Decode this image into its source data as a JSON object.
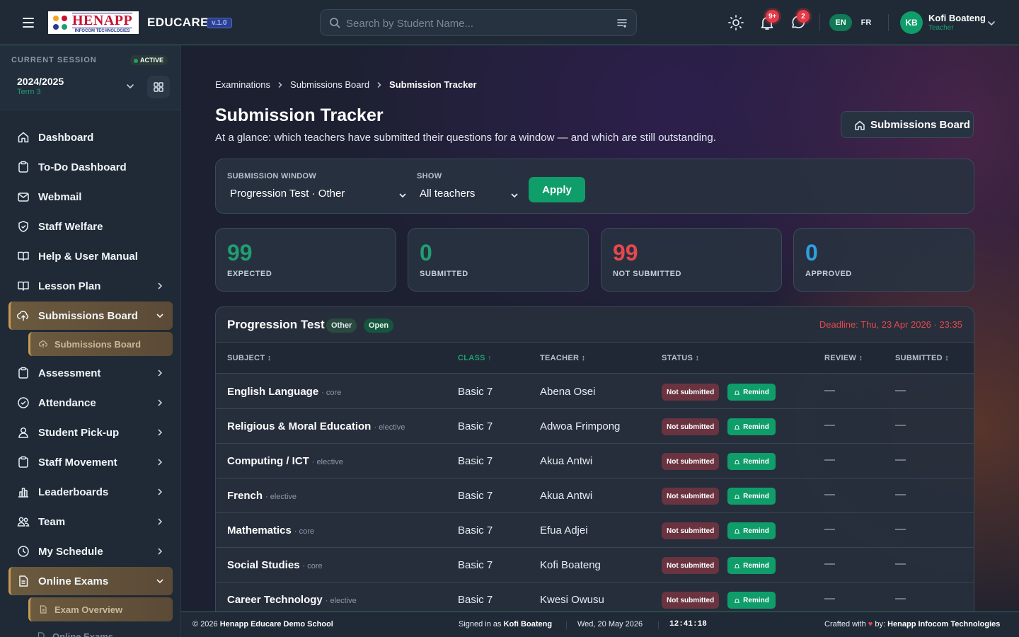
{
  "app": {
    "logo_main": "HENAPP",
    "logo_sub": "INFOCOM TECHNOLOGIES",
    "brand": "EDUCARE",
    "version": "v.1.0"
  },
  "search": {
    "placeholder": "Search by Student Name..."
  },
  "notifications": {
    "alerts_count": "9+",
    "messages_count": "2"
  },
  "languages": [
    "EN",
    "FR"
  ],
  "user": {
    "initials": "KB",
    "name": "Kofi Boateng",
    "role": "Teacher"
  },
  "session": {
    "label": "CURRENT SESSION",
    "status": "ACTIVE",
    "year": "2024/2025",
    "term": "Term 3"
  },
  "sidebar": {
    "items": [
      {
        "label": "Dashboard",
        "icon": "home-icon"
      },
      {
        "label": "To-Do Dashboard",
        "icon": "clipboard-icon"
      },
      {
        "label": "Webmail",
        "icon": "mail-icon"
      },
      {
        "label": "Staff Welfare",
        "icon": "shield-icon"
      },
      {
        "label": "Help & User Manual",
        "icon": "book-icon"
      },
      {
        "label": "Lesson Plan",
        "icon": "book-open-icon"
      },
      {
        "label": "Submissions Board",
        "icon": "upload-cloud-icon"
      },
      {
        "label": "Submissions Board",
        "icon": "sub-icon"
      },
      {
        "label": "Assessment",
        "icon": "clipboard-icon"
      },
      {
        "label": "Attendance",
        "icon": "check-circle-icon"
      },
      {
        "label": "Student Pick-up",
        "icon": "user-icon"
      },
      {
        "label": "Staff Movement",
        "icon": "clipboard-icon"
      },
      {
        "label": "Leaderboards",
        "icon": "bar-chart-icon"
      },
      {
        "label": "Team",
        "icon": "team-icon"
      },
      {
        "label": "My Schedule",
        "icon": "clock-icon"
      },
      {
        "label": "Online Exams",
        "icon": "document-icon"
      },
      {
        "label": "Exam Overview",
        "icon": "sub-icon"
      },
      {
        "label": "Online Exams",
        "icon": "sub-icon"
      }
    ]
  },
  "breadcrumb": [
    "Examinations",
    "Submissions Board",
    "Submission Tracker"
  ],
  "page": {
    "title": "Submission Tracker",
    "subtitle": "At a glance: which teachers have submitted their questions for a window — and which are still outstanding.",
    "header_button": "Submissions Board"
  },
  "filters": {
    "window_label": "SUBMISSION WINDOW",
    "window_value": "Progression Test · Other",
    "show_label": "SHOW",
    "show_value": "All teachers",
    "apply_label": "Apply"
  },
  "stats": [
    {
      "value": "99",
      "label": "EXPECTED",
      "color": "#1f9e72"
    },
    {
      "value": "0",
      "label": "SUBMITTED",
      "color": "#1f9e72"
    },
    {
      "value": "99",
      "label": "NOT SUBMITTED",
      "color": "#e5484d"
    },
    {
      "value": "0",
      "label": "APPROVED",
      "color": "#2f9fe0"
    }
  ],
  "table": {
    "title": "Progression Test",
    "type_pill": "Other",
    "state_pill": "Open",
    "deadline": "Deadline: Thu, 23 Apr 2026 · 23:35",
    "columns": [
      "SUBJECT ↕",
      "CLASS ↑",
      "TEACHER ↕",
      "STATUS ↕",
      "REVIEW ↕",
      "SUBMITTED ↕"
    ],
    "status_label": "Not submitted",
    "remind_label": "Remind",
    "empty_value": "—",
    "rows": [
      {
        "subject": "English Language",
        "tag": "· core",
        "class": "Basic 7",
        "teacher": "Abena Osei"
      },
      {
        "subject": "Religious & Moral Education",
        "tag": "· elective",
        "class": "Basic 7",
        "teacher": "Adwoa Frimpong"
      },
      {
        "subject": "Computing / ICT",
        "tag": "· elective",
        "class": "Basic 7",
        "teacher": "Akua Antwi"
      },
      {
        "subject": "French",
        "tag": "· elective",
        "class": "Basic 7",
        "teacher": "Akua Antwi"
      },
      {
        "subject": "Mathematics",
        "tag": "· core",
        "class": "Basic 7",
        "teacher": "Efua Adjei"
      },
      {
        "subject": "Social Studies",
        "tag": "· core",
        "class": "Basic 7",
        "teacher": "Kofi Boateng"
      },
      {
        "subject": "Career Technology",
        "tag": "· elective",
        "class": "Basic 7",
        "teacher": "Kwesi Owusu"
      }
    ]
  },
  "footer": {
    "copyright_prefix": "© 2026",
    "school": "Henapp Educare Demo School",
    "signed_prefix": "Signed in as",
    "signed_user": "Kofi Boateng",
    "date": "Wed, 20 May 2026",
    "time": "12:41:18",
    "crafted_prefix": "Crafted with",
    "crafted_by": "by:",
    "company": "Henapp Infocom Technologies"
  }
}
